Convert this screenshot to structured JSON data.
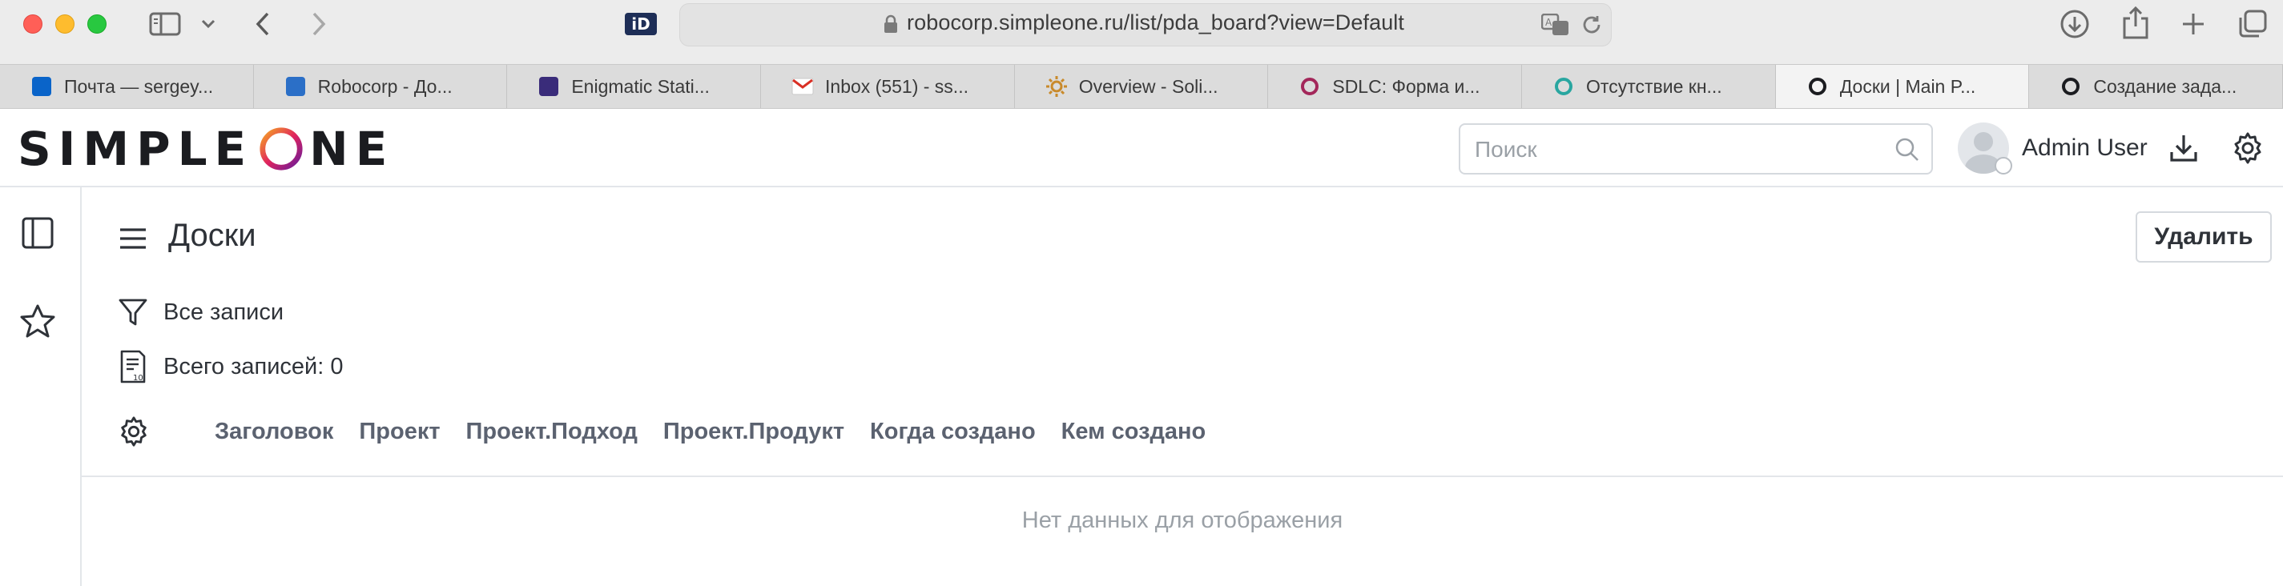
{
  "browser": {
    "address": "robocorp.simpleone.ru/list/pda_board?view=Default",
    "id_badge": "iD",
    "tabs": [
      {
        "label": "Почта — sergey...",
        "favicon": "outlook-icon",
        "color": "#0a64c9",
        "active": false
      },
      {
        "label": "Robocorp - До...",
        "favicon": "sharepoint-icon",
        "color": "#2b6fc7",
        "active": false
      },
      {
        "label": "Enigmatic Stati...",
        "favicon": "enigmatic-icon",
        "color": "#3a2c7a",
        "active": false
      },
      {
        "label": "Inbox (551) - ss...",
        "favicon": "gmail-icon",
        "color": "#d93025",
        "active": false
      },
      {
        "label": "Overview - Soli...",
        "favicon": "sun-icon",
        "color": "#c98a2b",
        "active": false
      },
      {
        "label": "SDLC: Форма и...",
        "favicon": "ring-icon",
        "color": "#a3275a",
        "active": false
      },
      {
        "label": "Отсутствие кн...",
        "favicon": "ring-icon",
        "color": "#29a6a0",
        "active": false
      },
      {
        "label": "Доски | Main P...",
        "favicon": "simpleone-icon",
        "color": "#1b1c20",
        "active": true
      },
      {
        "label": "Создание зада...",
        "favicon": "simpleone-icon",
        "color": "#1b1c20",
        "active": false
      }
    ]
  },
  "header": {
    "logo_left": "SIMPLE",
    "logo_right": "NE",
    "search_placeholder": "Поиск",
    "user_name": "Admin User"
  },
  "page": {
    "title": "Доски",
    "delete_label": "Удалить",
    "filter_label": "Все записи",
    "count_label": "Всего записей: 0",
    "columns": [
      "Заголовок",
      "Проект",
      "Проект.Подход",
      "Проект.Продукт",
      "Когда создано",
      "Кем создано"
    ],
    "empty_message": "Нет данных для отображения"
  },
  "colors": {
    "logo_ring_start": "#f08a24",
    "logo_ring_end": "#7b1fa2",
    "text": "#2e3238",
    "muted": "#9aa0a6"
  }
}
